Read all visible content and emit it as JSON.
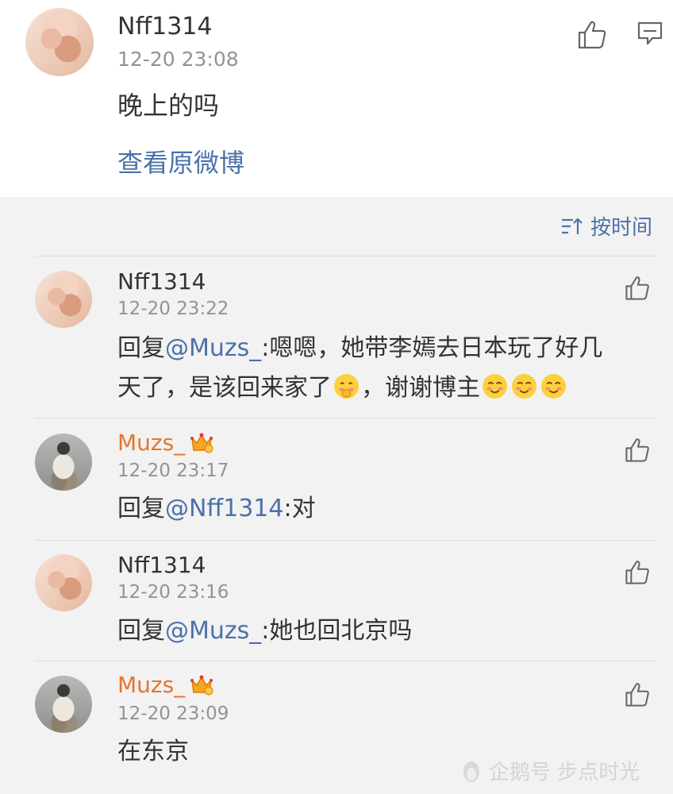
{
  "post": {
    "username": "Nff1314",
    "time": "12-20 23:08",
    "content": "晚上的吗",
    "view_original": "查看原微博"
  },
  "sort": {
    "label": "按时间"
  },
  "replies": [
    {
      "username": "Nff1314",
      "time": "12-20 23:22",
      "prefix": "回复",
      "mention": "@Muzs_",
      "line1": ":嗯嗯，她带李嫣去日本玩了好几",
      "line2": "天了，是该回来家了",
      "line2b": "，谢谢博主"
    },
    {
      "username": "Muzs_",
      "time": "12-20 23:17",
      "prefix": "回复",
      "mention": "@Nff1314",
      "text": ":对"
    },
    {
      "username": "Nff1314",
      "time": "12-20 23:16",
      "prefix": "回复",
      "mention": "@Muzs_",
      "text": ":她也回北京吗"
    },
    {
      "username": "Muzs_",
      "time": "12-20 23:09",
      "text": "在东京"
    }
  ],
  "watermark": {
    "text": "企鹅号 步点时光"
  },
  "colors": {
    "link": "#4b72a8",
    "vip_name": "#e8742a",
    "background": "#f2f2f2"
  }
}
